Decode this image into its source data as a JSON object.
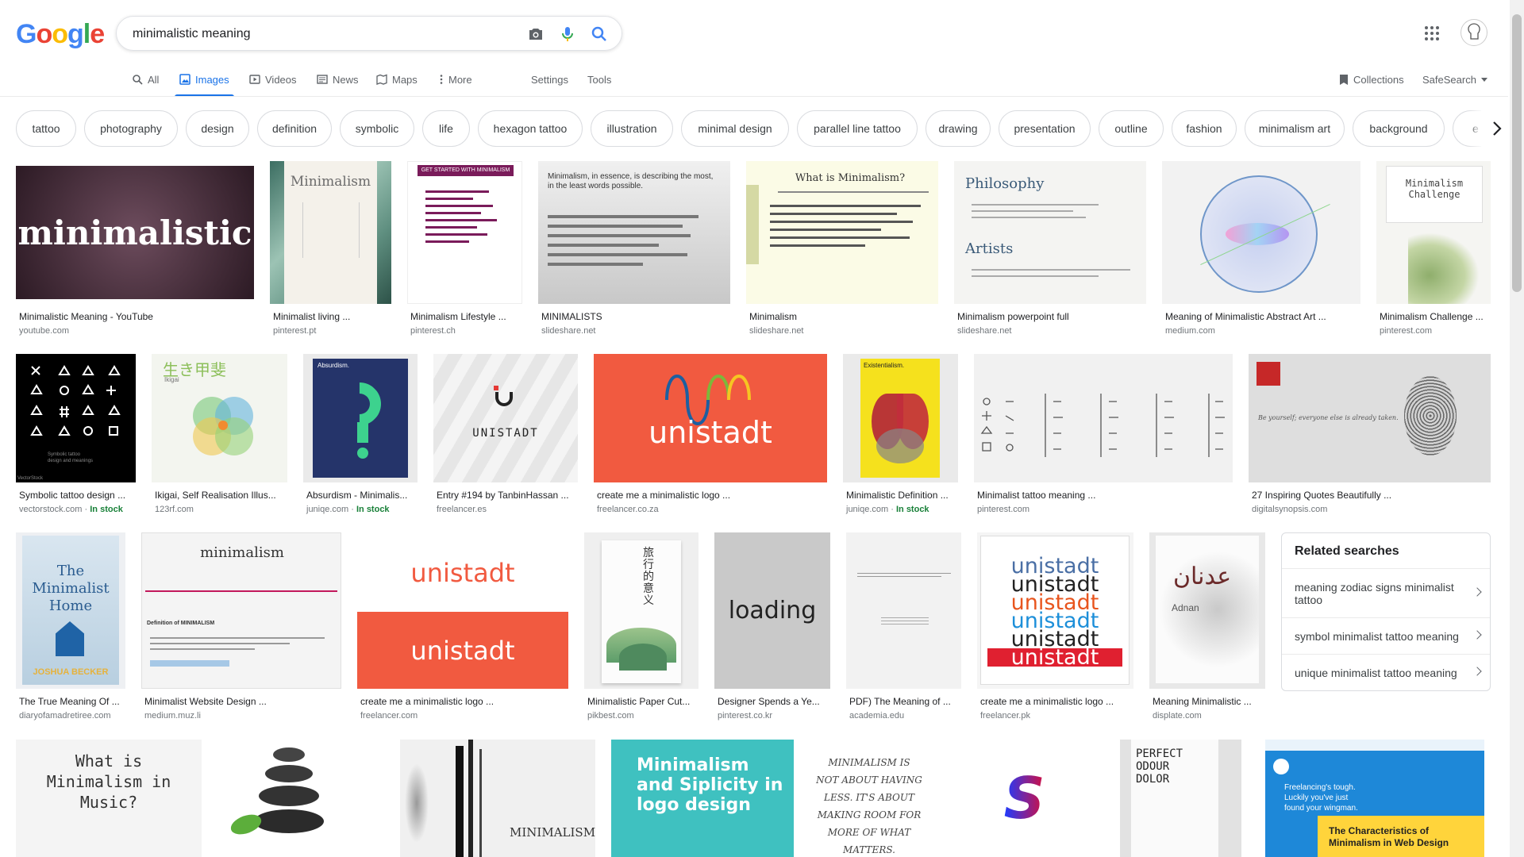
{
  "logo": {
    "letters": [
      "G",
      "o",
      "o",
      "g",
      "l",
      "e"
    ],
    "colors": [
      "#4285F4",
      "#EA4335",
      "#FBBC05",
      "#4285F4",
      "#34A853",
      "#EA4335"
    ]
  },
  "search": {
    "query": "minimalistic meaning",
    "icons": [
      "camera-icon",
      "microphone-icon",
      "search-icon"
    ]
  },
  "nav": {
    "tabs": [
      {
        "label": "All",
        "icon": "search-icon"
      },
      {
        "label": "Images",
        "icon": "image-icon"
      },
      {
        "label": "Videos",
        "icon": "play-icon"
      },
      {
        "label": "News",
        "icon": "news-icon"
      },
      {
        "label": "Maps",
        "icon": "map-icon"
      },
      {
        "label": "More",
        "icon": "more-icon"
      }
    ],
    "settings": "Settings",
    "tools": "Tools",
    "collections": "Collections",
    "safesearch": "SafeSearch"
  },
  "chips": [
    "tattoo",
    "photography",
    "design",
    "definition",
    "symbolic",
    "life",
    "hexagon tattoo",
    "illustration",
    "minimal design",
    "parallel line tattoo",
    "drawing",
    "presentation",
    "outline",
    "fashion",
    "minimalism art",
    "background",
    "e"
  ],
  "rows": [
    [
      {
        "title": "Minimalistic Meaning - YouTube",
        "source": "youtube.com",
        "art": "minimalistic"
      },
      {
        "title": "Minimalist living ...",
        "source": "pinterest.pt",
        "art": "Minimalism"
      },
      {
        "title": "Minimalism Lifestyle ...",
        "source": "pinterest.ch",
        "art": "GET STARTED WITH MINIMALISM"
      },
      {
        "title": "MINIMALISTS",
        "source": "slideshare.net",
        "art": "Minimalism, in essence, is describing the most, in the least words possible."
      },
      {
        "title": "Minimalism",
        "source": "slideshare.net",
        "art": "What is Minimalism?"
      },
      {
        "title": "Minimalism powerpoint full",
        "source": "slideshare.net",
        "art": "Philosophy"
      },
      {
        "title": "Meaning of Minimalistic Abstract Art ...",
        "source": "medium.com",
        "art": ""
      },
      {
        "title": "Minimalism Challenge ...",
        "source": "pinterest.com",
        "art": "Minimalism Challenge"
      }
    ],
    [
      {
        "title": "Symbolic tattoo design ...",
        "source": "vectorstock.com",
        "stock": "In stock",
        "art": "VectorStock"
      },
      {
        "title": "Ikigai, Self Realisation Illus...",
        "source": "123rf.com",
        "art": "生き甲斐"
      },
      {
        "title": "Absurdism - Minimalis...",
        "source": "juniqe.com",
        "stock": "In stock",
        "art": "Absurdism."
      },
      {
        "title": "Entry #194 by TanbinHassan ...",
        "source": "freelancer.es",
        "art": "UNISTADT"
      },
      {
        "title": "create me a minimalistic logo ...",
        "source": "freelancer.co.za",
        "art": "unistadt"
      },
      {
        "title": "Minimalistic Definition ...",
        "source": "juniqe.com",
        "stock": "In stock",
        "art": "Existentialism."
      },
      {
        "title": "Minimalist tattoo meaning ...",
        "source": "pinterest.com",
        "art": ""
      },
      {
        "title": "27 Inspiring Quotes Beautifully ...",
        "source": "digitalsynopsis.com",
        "art": "Be yourself; everyone else is already taken."
      }
    ],
    [
      {
        "title": "The True Meaning Of ...",
        "source": "diaryofamadretiree.com",
        "art": "The Minimalist Home"
      },
      {
        "title": "Minimalist Website Design ...",
        "source": "medium.muz.li",
        "art": "minimalism"
      },
      {
        "title": "create me a minimalistic logo ...",
        "source": "freelancer.com",
        "art": "unistadt"
      },
      {
        "title": "Minimalistic Paper Cut...",
        "source": "pikbest.com",
        "art": "旅行的意义"
      },
      {
        "title": "Designer Spends a Ye...",
        "source": "pinterest.co.kr",
        "art": "loading"
      },
      {
        "title": "PDF) The Meaning of ...",
        "source": "academia.edu",
        "art": ""
      },
      {
        "title": "create me a minimalistic logo ...",
        "source": "freelancer.pk",
        "art": "unistadt"
      },
      {
        "title": "Meaning Minimalistic ...",
        "source": "displate.com",
        "art": "عدنان"
      }
    ],
    [
      {
        "title": "",
        "source": "",
        "art": "What is Minimalism in Music?"
      },
      {
        "title": "",
        "source": "",
        "art": ""
      },
      {
        "title": "",
        "source": "",
        "art": "MINIMALISM"
      },
      {
        "title": "",
        "source": "",
        "art": "Minimalism and Siplicity in logo design"
      },
      {
        "title": "",
        "source": "",
        "art": "MINIMALISM IS NOT ABOUT HAVING LESS. IT'S ABOUT MAKING ROOM FOR MORE OF WHAT MATTERS."
      },
      {
        "title": "",
        "source": "",
        "art": "S"
      },
      {
        "title": "",
        "source": "",
        "art": "PERFECT ODOUR DOLOR"
      },
      {
        "title": "",
        "source": "",
        "art": "The Characteristics of Minimalism in Web Design"
      }
    ]
  ],
  "related": {
    "heading": "Related searches",
    "items": [
      "meaning zodiac signs minimalist tattoo",
      "symbol minimalist tattoo meaning",
      "unique minimalist tattoo meaning"
    ]
  },
  "colors": {
    "accent": "#1a73e8",
    "stock": "#188038",
    "unistadt_red": "#f15a40",
    "teal": "#3fc1c0"
  }
}
